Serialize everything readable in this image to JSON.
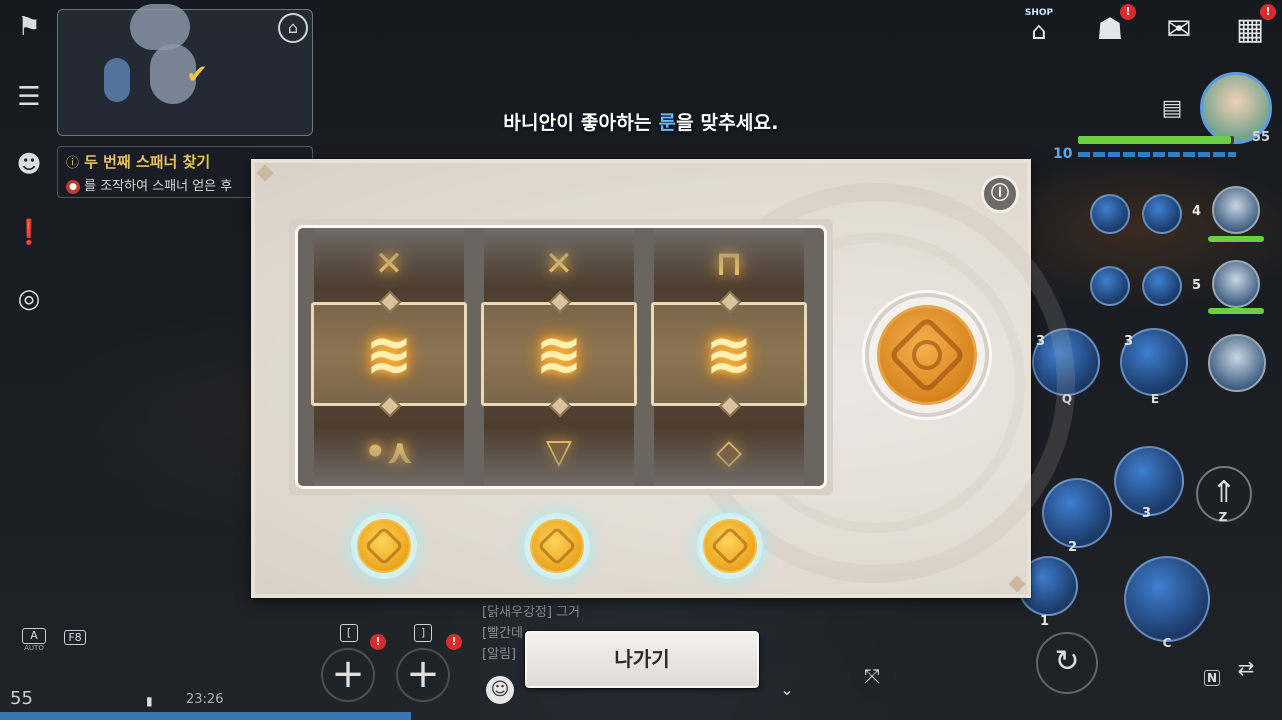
{
  "prompt": {
    "before": "바니안이 좋아하는 ",
    "highlight": "룬",
    "after": "을 맞추세요."
  },
  "quest": {
    "title": "두 번째 스패너 찾기",
    "description": "를 조작하여 스패너 얻은 후"
  },
  "shop": {
    "label": "SHOP"
  },
  "player": {
    "level_left": "10",
    "level_right": "55"
  },
  "skills": {
    "q_key": "Q",
    "e_key": "E",
    "z_key": "Z",
    "c_key": "C",
    "n_key": "N",
    "q_count": "3",
    "e_count": "3",
    "skill_2": "2",
    "skill_3": "3",
    "skill_1": "1",
    "ally_1_count": "4",
    "ally_2_count": "5"
  },
  "reels": [
    {
      "top": "✕",
      "main": "≋",
      "bottom": "•⋏"
    },
    {
      "top": "✕",
      "main": "≋",
      "bottom": "▽"
    },
    {
      "top": "⊓",
      "main": "≋",
      "bottom": "◇"
    }
  ],
  "chat": {
    "line1": "[닭새우강정] 그거",
    "line2": "[빨간데",
    "line3": "[알림]"
  },
  "bottom": {
    "level": "55",
    "time": "23:26",
    "auto_label": "AUTO",
    "f8_label": "F8",
    "auto_key": "A",
    "quick_key_1": "[",
    "quick_key_2": "]",
    "quick_plus": "+"
  },
  "exit_button": {
    "label": "나가기"
  },
  "icons": {
    "home": "home-icon",
    "info": "magnifier-info-icon",
    "mail": "mail-icon",
    "menu": "grid-menu-icon"
  },
  "colors": {
    "highlight": "#6fb7ff",
    "quest_title": "#e8c15a",
    "rune_glow": "#ffb43a",
    "panel": "#e2dbd2"
  }
}
